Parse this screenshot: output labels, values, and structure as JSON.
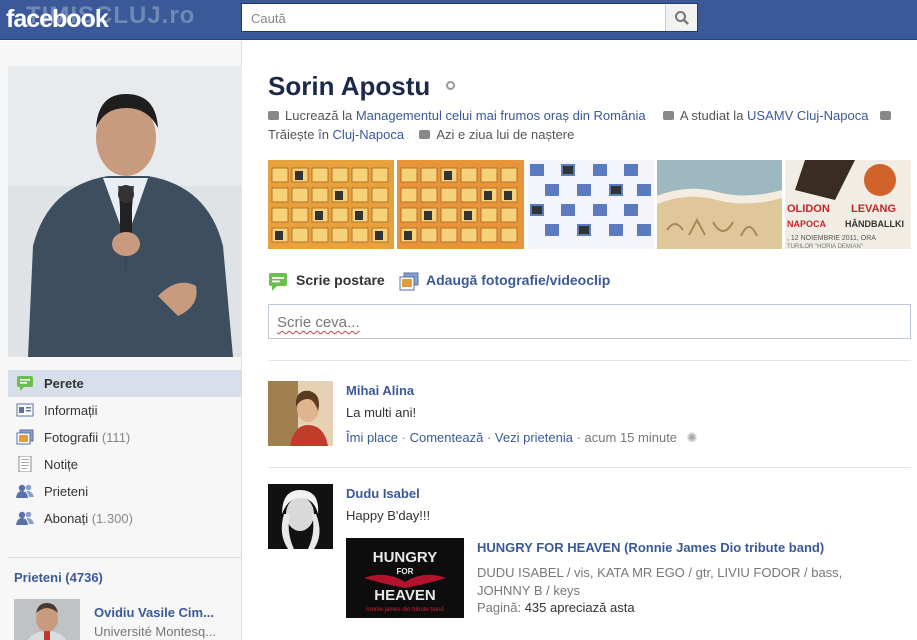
{
  "topbar": {
    "logo": "facebook",
    "watermark": "TIMISCLUJ.ro",
    "search_placeholder": "Caută"
  },
  "profile": {
    "name": "Sorin Apostu",
    "work_prefix": "Lucrează la ",
    "work_link": "Managementul celui mai frumos oraș din România",
    "study_prefix": "A studiat la ",
    "study_link": "USAMV Cluj-Napoca",
    "live_prefix": "Trăiește în ",
    "live_link": "Cluj-Napoca",
    "birthday": "Azi e ziua lui de naștere"
  },
  "nav": [
    {
      "label": "Perete",
      "count": "",
      "icon": "wall-icon"
    },
    {
      "label": "Informații",
      "count": "",
      "icon": "info-icon"
    },
    {
      "label": "Fotografii",
      "count": "(111)",
      "icon": "photos-icon"
    },
    {
      "label": "Notițe",
      "count": "",
      "icon": "notes-icon"
    },
    {
      "label": "Prieteni",
      "count": "",
      "icon": "friends-icon"
    },
    {
      "label": "Abonați",
      "count": "(1.300)",
      "icon": "subscribers-icon"
    }
  ],
  "friends": {
    "title": "Prieteni (4736)",
    "first_name": "Ovidiu Vasile Cim...",
    "first_sub": "Université Montesq..."
  },
  "strip_images": [
    {
      "icon": "calendar-photo-icon",
      "text": ""
    },
    {
      "icon": "calendar-photo-icon",
      "text": ""
    },
    {
      "icon": "photo-grid-icon",
      "text": ""
    },
    {
      "icon": "beach-photo-icon",
      "text": ""
    },
    {
      "icon": "poster-photo-icon",
      "text": "OLIDON LEVANG NAPOCA HÂNDBALLKI 12 NOIEMBRIE 2011, ORA TURILOR HORIA DEMIAN"
    }
  ],
  "composer": {
    "tab_post": "Scrie postare",
    "tab_photo": "Adaugă fotografie/videoclip",
    "placeholder": "Scrie ceva..."
  },
  "posts": [
    {
      "author": "Mihai Alina",
      "text": "La multi ani!",
      "like": "Îmi place",
      "comment": "Comentează",
      "friendship": "Vezi prietenia",
      "time": "acum 15 minute"
    },
    {
      "author": "Dudu Isabel",
      "text": "Happy B'day!!!",
      "share_title": "HUNGRY FOR HEAVEN (Ronnie James Dio tribute band)",
      "share_desc": "DUDU ISABEL / vis, KATA MR EGO / gtr, LIVIU FODOR / bass, JOHNNY B / keys",
      "share_page_label": "Pagină: ",
      "share_page_value": "435 apreciază asta",
      "share_img_line1": "HUNGRY",
      "share_img_line2": "FOR",
      "share_img_line3": "HEAVEN",
      "share_img_line4": "ronnie james dio tribute band"
    }
  ],
  "colors": {
    "brand": "#3b5998",
    "nav_active": "#d8dfea"
  }
}
